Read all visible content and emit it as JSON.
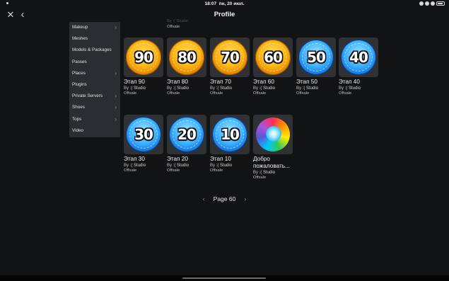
{
  "status_bar": {
    "time": "18:07",
    "date": "пн, 20 июл."
  },
  "nav": {
    "title": "Profile",
    "close_glyph": "✕",
    "back_glyph": "‹"
  },
  "dropdown": {
    "chevron": "›",
    "items": [
      {
        "label": "Makeup",
        "has_submenu": true
      },
      {
        "label": "Meshes",
        "has_submenu": false
      },
      {
        "label": "Models & Packages",
        "has_submenu": false
      },
      {
        "label": "Passes",
        "has_submenu": false
      },
      {
        "label": "Places",
        "has_submenu": true
      },
      {
        "label": "Plugins",
        "has_submenu": false
      },
      {
        "label": "Private Servers",
        "has_submenu": true
      },
      {
        "label": "Shoes",
        "has_submenu": true
      },
      {
        "label": "Tops",
        "has_submenu": true
      },
      {
        "label": "Video",
        "has_submenu": false
      }
    ]
  },
  "previous_row_remnant": {
    "creator": "By :( Studio",
    "price": "Offsale"
  },
  "items": [
    {
      "name": "Этап 90",
      "by": "By",
      "creator": ":( Studio",
      "price": "Offsale",
      "badge_number": "90",
      "badge_color": "gold"
    },
    {
      "name": "Этап 80",
      "by": "By",
      "creator": ":( Studio",
      "price": "Offsale",
      "badge_number": "80",
      "badge_color": "gold"
    },
    {
      "name": "Этап 70",
      "by": "By",
      "creator": ":( Studio",
      "price": "Offsale",
      "badge_number": "70",
      "badge_color": "gold"
    },
    {
      "name": "Этап 60",
      "by": "By",
      "creator": ":( Studio",
      "price": "Offsale",
      "badge_number": "60",
      "badge_color": "gold"
    },
    {
      "name": "Этап 50",
      "by": "By",
      "creator": ":( Studio",
      "price": "Offsale",
      "badge_number": "50",
      "badge_color": "blue"
    },
    {
      "name": "Этап 40",
      "by": "By",
      "creator": ":( Studio",
      "price": "Offsale",
      "badge_number": "40",
      "badge_color": "blue"
    },
    {
      "name": "Этап 30",
      "by": "By",
      "creator": ":( Studio",
      "price": "Offsale",
      "badge_number": "30",
      "badge_color": "blue"
    },
    {
      "name": "Этап 20",
      "by": "By",
      "creator": ":( Studio",
      "price": "Offsale",
      "badge_number": "20",
      "badge_color": "blue"
    },
    {
      "name": "Этап 10",
      "by": "By",
      "creator": ":( Studio",
      "price": "Offsale",
      "badge_number": "10",
      "badge_color": "blue"
    },
    {
      "name_line1": "Добро",
      "name_line2": "пожаловать...",
      "by": "By",
      "creator": ":( Studio",
      "price": "Offsale"
    }
  ],
  "pagination": {
    "label": "Page 60",
    "prev_glyph": "‹",
    "next_glyph": "›"
  },
  "colors": {
    "background": "#121314",
    "menu": "#2b2d30",
    "tile": "#2f3134",
    "badge_gold": "#fdb813",
    "badge_blue": "#3fb4ff"
  }
}
